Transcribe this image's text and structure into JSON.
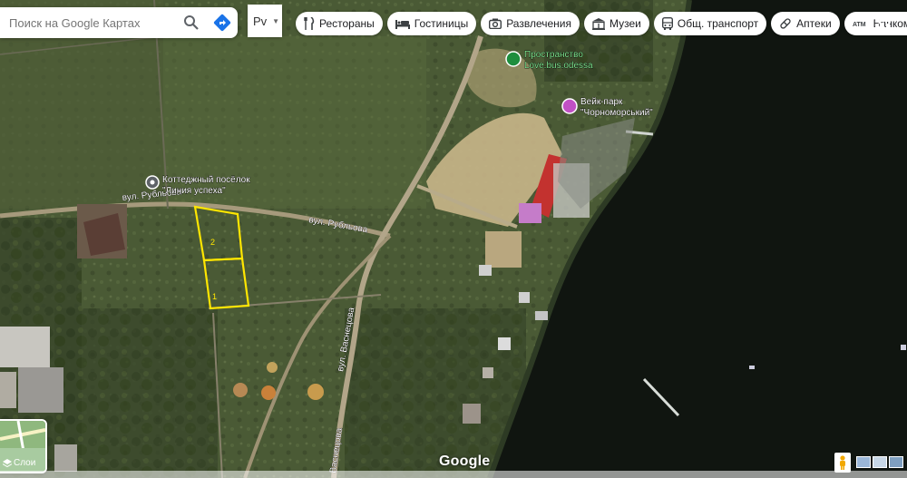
{
  "search": {
    "placeholder": "Поиск на Google Картах"
  },
  "language": {
    "label": "Рv"
  },
  "chips": [
    {
      "icon": "fork-knife-icon",
      "label": "Рестораны"
    },
    {
      "icon": "bed-icon",
      "label": "Гостиницы"
    },
    {
      "icon": "camera-icon",
      "label": "Развлечения"
    },
    {
      "icon": "museum-icon",
      "label": "Музеи"
    },
    {
      "icon": "bus-icon",
      "label": "Общ. транспорт"
    },
    {
      "icon": "pill-icon",
      "label": "Аптеки"
    },
    {
      "icon": "atm-icon",
      "label": "Банкоматы"
    }
  ],
  "map": {
    "places": [
      {
        "name_line1": "Пространство",
        "name_line2": "Love.bus.odessa",
        "icon": "leaf-pin-icon",
        "color": "#1e8e3e"
      },
      {
        "name_line1": "Вейк-парк",
        "name_line2": "\"Чорноморський\"",
        "icon": "pink-pin-icon",
        "color": "#c150c4"
      },
      {
        "name_line1": "Коттеджный посёлок",
        "name_line2": "\"Линия успеха\"",
        "icon": "grey-pin-icon",
        "color": "#5f6368"
      }
    ],
    "streets": [
      "вул. Рубльова",
      "вул. Рубльова",
      "вул. Васнецова",
      "Васнецова"
    ],
    "plots": [
      "2",
      "1"
    ],
    "plot_color": "#ffe600"
  },
  "layers": {
    "label": "Слои"
  },
  "attribution": {
    "logo": "Google"
  }
}
